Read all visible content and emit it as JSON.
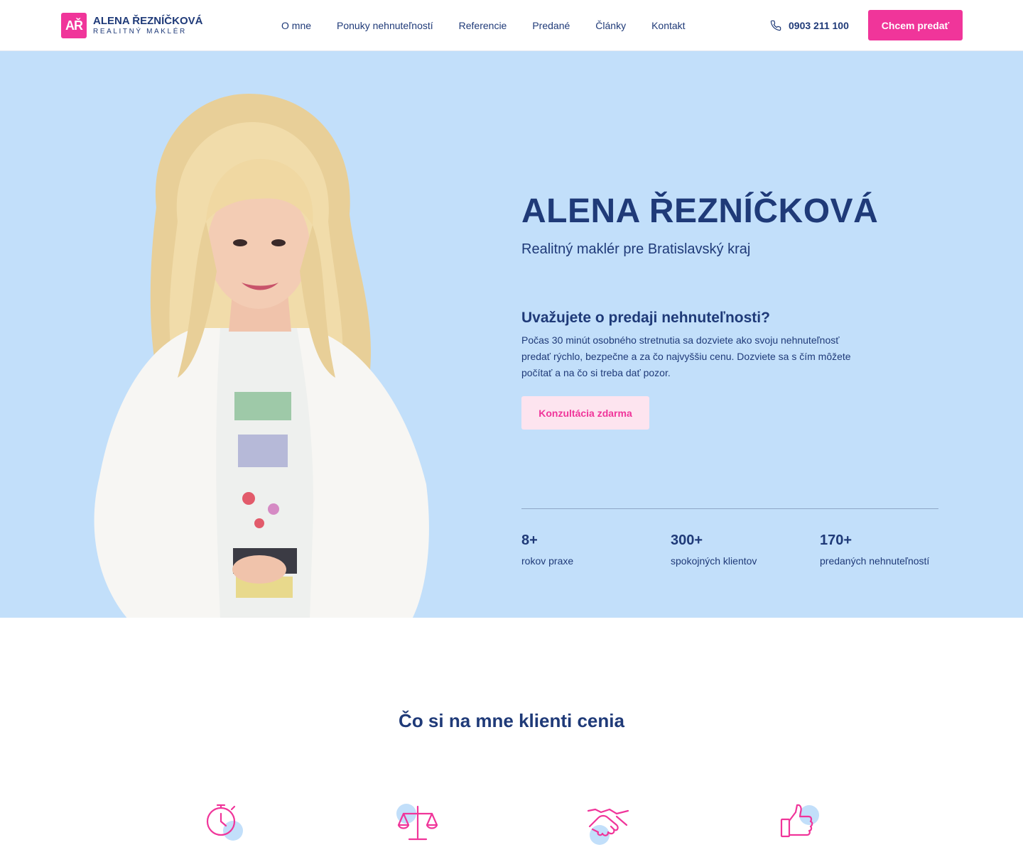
{
  "header": {
    "logo_mark": "AŘ",
    "logo_name": "ALENA ŘEZNÍČKOVÁ",
    "logo_sub": "REALITNÝ MAKLÉR",
    "nav": [
      "O mne",
      "Ponuky nehnuteľností",
      "Referencie",
      "Predané",
      "Články",
      "Kontakt"
    ],
    "phone_icon": "phone-icon",
    "phone": "0903 211 100",
    "cta": "Chcem predať"
  },
  "hero": {
    "title": "ALENA ŘEZNÍČKOVÁ",
    "subtitle": "Realitný maklér pre Bratislavský kraj",
    "question": "Uvažujete o predaji nehnuteľnosti?",
    "paragraph": "Počas 30 minút osobného stretnutia sa dozviete ako svoju nehnuteľnosť predať rýchlo, bezpečne a za čo najvyššiu cenu. Dozviete sa s čím môžete počítať a na čo si treba dať pozor.",
    "button": "Konzultácia zdarma",
    "stats": [
      {
        "number": "8+",
        "label": "rokov praxe"
      },
      {
        "number": "300+",
        "label": "spokojných klientov"
      },
      {
        "number": "170+",
        "label": "predaných nehnuteľností"
      }
    ]
  },
  "values": {
    "title": "Čo si na mne klienti cenia",
    "icons": [
      "stopwatch-icon",
      "scales-icon",
      "handshake-icon",
      "thumbs-up-icon"
    ]
  },
  "colors": {
    "brand_pink": "#f0359a",
    "navy": "#1f3a78",
    "hero_bg": "#c2dffa",
    "light_pink": "#fde4ef",
    "icon_blue_dot": "#c2dffa"
  }
}
